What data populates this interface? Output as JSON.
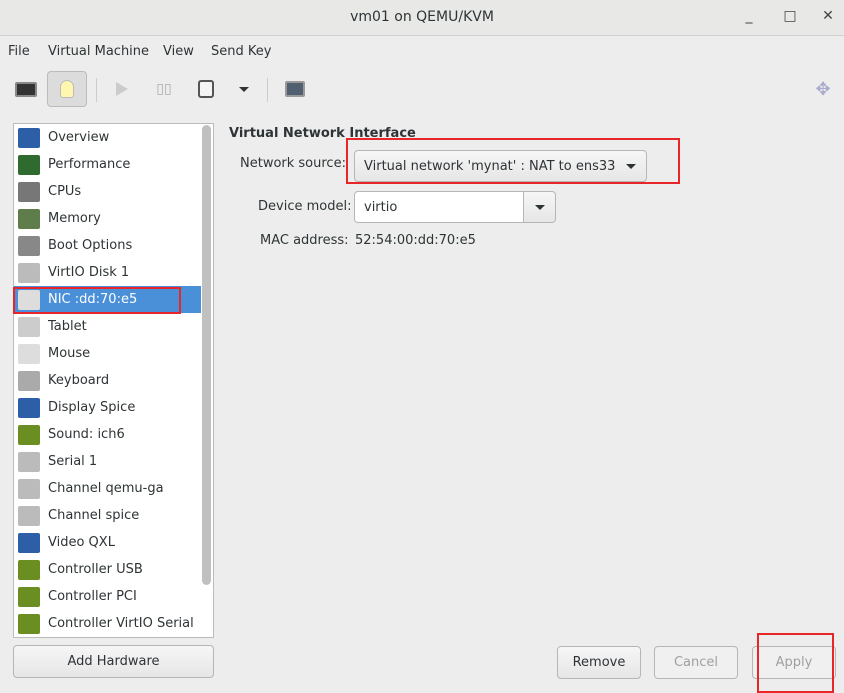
{
  "window": {
    "title": "vm01 on QEMU/KVM",
    "minimize": "_",
    "maximize": "□",
    "close": "✕"
  },
  "menu": [
    "File",
    "Virtual Machine",
    "View",
    "Send Key"
  ],
  "toolbar": {
    "icons": [
      "monitor-icon",
      "lightbulb-icon",
      "play-icon",
      "pause-icon",
      "power-icon",
      "dropdown-arrow-icon",
      "screens-icon",
      "fullscreen-icon"
    ]
  },
  "sidebar": {
    "selected": 6,
    "items": [
      {
        "label": "Overview",
        "icon": "overview-icon",
        "color": "#2c5fa8"
      },
      {
        "label": "Performance",
        "icon": "performance-icon",
        "color": "#2f6b2f"
      },
      {
        "label": "CPUs",
        "icon": "cpu-icon",
        "color": "#777777"
      },
      {
        "label": "Memory",
        "icon": "memory-icon",
        "color": "#5e7d4a"
      },
      {
        "label": "Boot Options",
        "icon": "gears-icon",
        "color": "#888888"
      },
      {
        "label": "VirtIO Disk 1",
        "icon": "disk-icon",
        "color": "#bbbbbb"
      },
      {
        "label": "NIC :dd:70:e5",
        "icon": "nic-icon",
        "color": "#dddddd"
      },
      {
        "label": "Tablet",
        "icon": "tablet-icon",
        "color": "#cccccc"
      },
      {
        "label": "Mouse",
        "icon": "mouse-icon",
        "color": "#dddddd"
      },
      {
        "label": "Keyboard",
        "icon": "keyboard-icon",
        "color": "#aaaaaa"
      },
      {
        "label": "Display Spice",
        "icon": "display-icon",
        "color": "#2c5fa8"
      },
      {
        "label": "Sound: ich6",
        "icon": "sound-icon",
        "color": "#6b8e23"
      },
      {
        "label": "Serial 1",
        "icon": "serial-icon",
        "color": "#bbbbbb"
      },
      {
        "label": "Channel qemu-ga",
        "icon": "channel-icon",
        "color": "#bbbbbb"
      },
      {
        "label": "Channel spice",
        "icon": "channel-icon",
        "color": "#bbbbbb"
      },
      {
        "label": "Video QXL",
        "icon": "video-icon",
        "color": "#2c5fa8"
      },
      {
        "label": "Controller USB",
        "icon": "controller-icon",
        "color": "#6b8e23"
      },
      {
        "label": "Controller PCI",
        "icon": "controller-icon",
        "color": "#6b8e23"
      },
      {
        "label": "Controller VirtIO Serial",
        "icon": "controller-icon",
        "color": "#6b8e23"
      }
    ]
  },
  "add_hardware": "Add Hardware",
  "details": {
    "heading": "Virtual Network Interface",
    "network_source_label": "Network source:",
    "network_source_value": "Virtual network 'mynat' : NAT to ens33",
    "device_model_label": "Device model:",
    "device_model_value": "virtio",
    "mac_label": "MAC address:",
    "mac_value": "52:54:00:dd:70:e5"
  },
  "buttons": {
    "remove": "Remove",
    "cancel": "Cancel",
    "apply": "Apply"
  },
  "colors": {
    "selection": "#4a90d9",
    "highlight_box": "#e8262a"
  }
}
